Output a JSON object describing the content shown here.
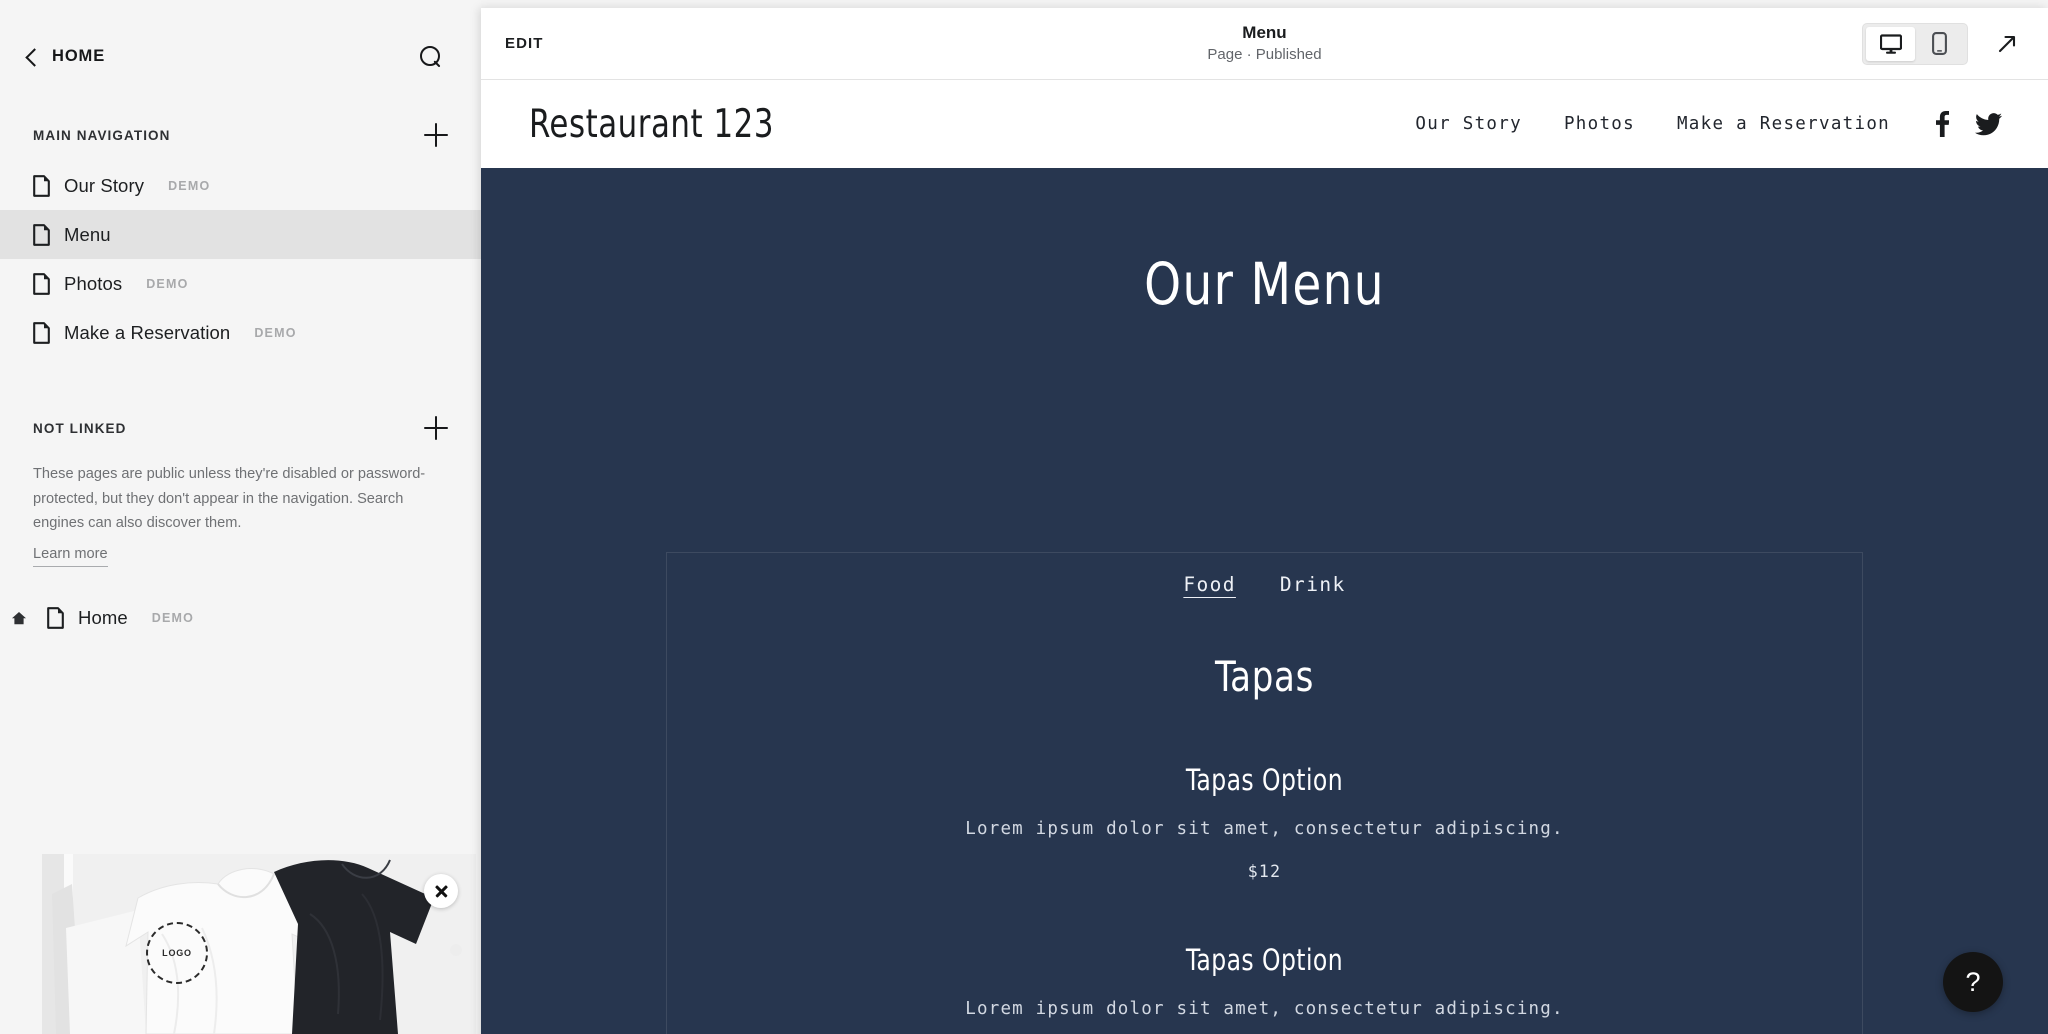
{
  "sidebar": {
    "back_label": "HOME",
    "search_icon": "search-icon",
    "main_nav": {
      "title": "MAIN NAVIGATION",
      "add_label": "+",
      "items": [
        {
          "label": "Our Story",
          "badge": "DEMO",
          "active": false,
          "home": false
        },
        {
          "label": "Menu",
          "badge": "",
          "active": true,
          "home": false
        },
        {
          "label": "Photos",
          "badge": "DEMO",
          "active": false,
          "home": false
        },
        {
          "label": "Make a Reservation",
          "badge": "DEMO",
          "active": false,
          "home": false
        }
      ]
    },
    "not_linked": {
      "title": "NOT LINKED",
      "add_label": "+",
      "description": "These pages are public unless they're disabled or password-protected, but they don't appear in the navigation. Search engines can also discover them.",
      "learn_more": "Learn more",
      "items": [
        {
          "label": "Home",
          "badge": "DEMO",
          "active": false,
          "home": true
        }
      ]
    },
    "promo": {
      "logo_placeholder": "LOGO",
      "close_icon": "close-icon"
    }
  },
  "toolbar": {
    "edit_label": "EDIT",
    "page_title": "Menu",
    "page_status": "Page · Published",
    "desktop_icon": "desktop-icon",
    "mobile_icon": "mobile-icon",
    "external_icon": "external-link-icon",
    "desktop_selected": true,
    "mobile_selected": false
  },
  "site": {
    "brand": "Restaurant 123",
    "nav": [
      {
        "label": "Our Story"
      },
      {
        "label": "Photos"
      },
      {
        "label": "Make a Reservation"
      }
    ],
    "social": [
      {
        "name": "facebook-icon"
      },
      {
        "name": "twitter-icon"
      }
    ],
    "background_color": "#27364f",
    "heading": "Our Menu",
    "tabs": [
      {
        "label": "Food",
        "selected": true
      },
      {
        "label": "Drink",
        "selected": false
      }
    ],
    "category": "Tapas",
    "dishes": [
      {
        "name": "Tapas Option",
        "description": "Lorem ipsum dolor sit amet, consectetur adipiscing.",
        "price": "$12"
      },
      {
        "name": "Tapas Option",
        "description": "Lorem ipsum dolor sit amet, consectetur adipiscing.",
        "price": ""
      }
    ]
  },
  "help": {
    "label": "?"
  },
  "cursor": {
    "name": "pointer-cursor",
    "color": "#2b5fd4"
  }
}
